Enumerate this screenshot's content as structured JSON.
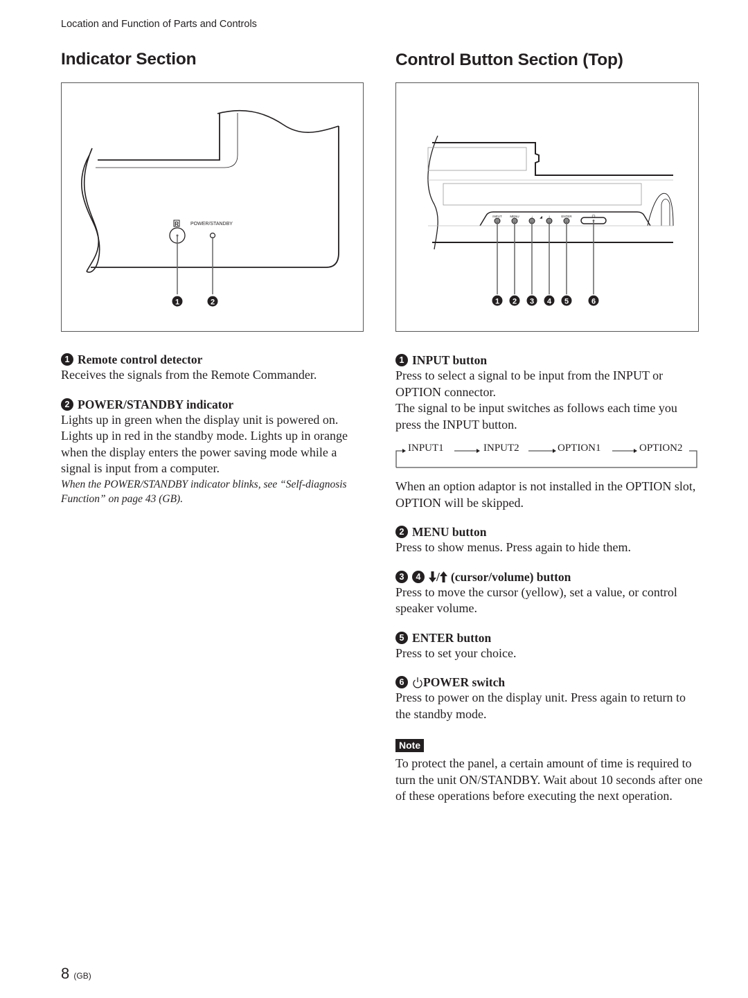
{
  "running_head": "Location and Function of Parts and Controls",
  "left": {
    "title": "Indicator Section",
    "figure": {
      "remote_symbol": "R",
      "indicator_label": "POWER/STANDBY",
      "callouts": [
        "1",
        "2"
      ]
    },
    "items": [
      {
        "number": "1",
        "heading": "Remote control detector",
        "body": "Receives the signals from the Remote Commander."
      },
      {
        "number": "2",
        "heading": "POWER/STANDBY indicator",
        "body": "Lights up in green when the display unit is powered on. Lights up in red in the standby mode. Lights up in orange when the display enters the power saving mode while a signal is input from a computer.",
        "note": "When the POWER/STANDBY indicator blinks, see “Self-diagnosis Function” on page 43 (GB)."
      }
    ]
  },
  "right": {
    "title": "Control Button Section (Top)",
    "figure": {
      "button_labels": [
        "INPUT",
        "MENU",
        "↓",
        "↑",
        "ENTER",
        "⏻"
      ],
      "callouts": [
        "1",
        "2",
        "3",
        "4",
        "5",
        "6"
      ]
    },
    "items": [
      {
        "number": "1",
        "heading": "INPUT button",
        "body1": "Press to select a signal to be input from the INPUT or OPTION connector.",
        "body2": "The signal to be input switches as follows each time you press the INPUT button.",
        "flow": [
          "INPUT1",
          "INPUT2",
          "OPTION1",
          "OPTION2"
        ],
        "body3": "When an option adaptor is not installed in the OPTION slot, OPTION will be skipped."
      },
      {
        "number": "2",
        "heading": "MENU button",
        "body": "Press to show menus. Press again to hide them."
      },
      {
        "numbers": [
          "3",
          "4"
        ],
        "heading_icons": [
          "down-arrow-icon",
          "up-arrow-icon"
        ],
        "heading_sep": "/",
        "heading": "(cursor/volume) button",
        "body": "Press to move the cursor (yellow), set a value, or control speaker volume."
      },
      {
        "number": "5",
        "heading": "ENTER button",
        "body": "Press to set your choice."
      },
      {
        "number": "6",
        "heading": "POWER switch",
        "body": "Press to power on the display unit. Press again to return to the standby mode."
      }
    ],
    "note": {
      "label": "Note",
      "body": "To protect the panel, a certain amount of time is required to turn the unit ON/STANDBY. Wait about 10 seconds after one of these operations before executing the next operation."
    }
  },
  "footer": {
    "page_number": "8",
    "region": "(GB)"
  }
}
